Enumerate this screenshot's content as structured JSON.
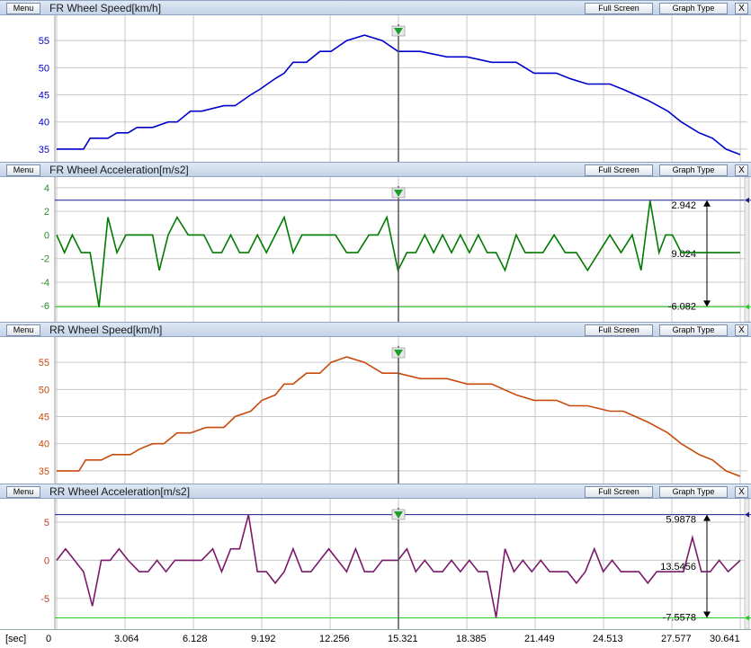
{
  "buttons": {
    "menu": "Menu",
    "full_screen": "Full Screen",
    "graph_type": "Graph Type",
    "close": "X"
  },
  "colors": {
    "blue": "#0000cc",
    "green": "#007a00",
    "orange": "#c84a0a",
    "purple": "#7a1a6a",
    "limit_upper": "#1c1c8c",
    "limit_lower": "#22cc22",
    "grid": "#c8c8c8",
    "cursor": "#555555"
  },
  "x_axis": {
    "unit": "[sec]",
    "ticks": [
      "0",
      "3.064",
      "6.128",
      "9.192",
      "12.256",
      "15.321",
      "18.385",
      "21.449",
      "24.513",
      "27.577",
      "30.641"
    ],
    "max": 30.641,
    "cursor_x": 15.321
  },
  "panels": [
    {
      "title": "FR Wheel Speed[km/h]",
      "menu_label": "Menu",
      "chart_data": {
        "type": "line",
        "ylim": [
          33,
          59
        ],
        "yticks": [
          35,
          40,
          45,
          50,
          55
        ],
        "tick_color": "#0000cc",
        "color": "#0000cc",
        "x": [
          0,
          1.2,
          1.5,
          2.3,
          2.7,
          3.2,
          3.6,
          4.3,
          5.0,
          5.4,
          6.0,
          6.5,
          7.5,
          8.0,
          8.7,
          9.1,
          9.8,
          10.2,
          10.6,
          11.2,
          11.8,
          12.3,
          13.0,
          13.8,
          14.6,
          15.3,
          16.3,
          17.5,
          18.4,
          19.5,
          20.6,
          21.4,
          22.4,
          23.0,
          23.8,
          24.8,
          25.4,
          26.5,
          27.4,
          28.0,
          28.8,
          29.4,
          30.0,
          30.641
        ],
        "y": [
          35,
          35,
          37,
          37,
          38,
          38,
          39,
          39,
          40,
          40,
          42,
          42,
          43,
          43,
          45,
          46,
          48,
          49,
          51,
          51,
          53,
          53,
          55,
          56,
          55,
          53,
          53,
          52,
          52,
          51,
          51,
          49,
          49,
          48,
          47,
          47,
          46,
          44,
          42,
          40,
          38,
          37,
          35,
          34
        ]
      },
      "markers": null
    },
    {
      "title": "FR Wheel Acceleration[m/s2]",
      "menu_label": "Menu",
      "chart_data": {
        "type": "line",
        "ylim": [
          -7.2,
          4.6
        ],
        "yticks": [
          4,
          2,
          0,
          -2,
          -4,
          -6
        ],
        "tick_color": "#2a8a2a",
        "color": "#007a00",
        "x": [
          0,
          0.35,
          0.7,
          1.1,
          1.5,
          1.9,
          2.3,
          2.7,
          3.1,
          3.5,
          4.0,
          4.3,
          4.6,
          5.0,
          5.4,
          5.9,
          6.2,
          6.6,
          7.0,
          7.4,
          7.8,
          8.2,
          8.6,
          9.0,
          9.4,
          9.8,
          10.2,
          10.6,
          11.0,
          11.5,
          12.0,
          12.5,
          13.0,
          13.5,
          14.0,
          14.4,
          14.8,
          15.3,
          15.7,
          16.1,
          16.5,
          16.9,
          17.3,
          17.7,
          18.1,
          18.5,
          18.9,
          19.3,
          19.7,
          20.1,
          20.6,
          21.0,
          21.4,
          21.8,
          22.3,
          22.8,
          23.3,
          23.8,
          24.3,
          24.8,
          25.3,
          25.8,
          26.2,
          26.6,
          27.0,
          27.3,
          27.6,
          28.0,
          28.4,
          28.8,
          29.3,
          29.8,
          30.2,
          30.641
        ],
        "y": [
          0,
          -1.5,
          0,
          -1.5,
          -1.5,
          -6.1,
          1.5,
          -1.5,
          0,
          0,
          0,
          0,
          -3.0,
          0,
          1.5,
          0,
          0,
          0,
          -1.5,
          -1.5,
          0,
          -1.5,
          -1.5,
          0,
          -1.5,
          0,
          1.5,
          -1.5,
          0,
          0,
          0,
          0,
          -1.5,
          -1.5,
          0,
          0,
          1.5,
          -3.0,
          -1.5,
          -1.5,
          0,
          -1.5,
          0,
          -1.5,
          0,
          -1.5,
          0,
          -1.5,
          -1.5,
          -3.0,
          0,
          -1.5,
          -1.5,
          -1.5,
          0,
          -1.5,
          -1.5,
          -3.0,
          -1.5,
          0,
          -1.5,
          0,
          -3.0,
          2.9,
          -1.5,
          0,
          0,
          -1.5,
          -1.5,
          -1.5,
          -1.5,
          -1.5,
          -1.5,
          -1.5
        ]
      },
      "markers": {
        "upper": 2.942,
        "lower": -6.082,
        "upper_label": "2.942",
        "mid_label": "9.024",
        "lower_label": "-6.082"
      }
    },
    {
      "title": "RR Wheel Speed[km/h]",
      "menu_label": "Menu",
      "chart_data": {
        "type": "line",
        "ylim": [
          33,
          59
        ],
        "yticks": [
          35,
          40,
          45,
          50,
          55
        ],
        "tick_color": "#c84a0a",
        "color": "#c84a0a",
        "x": [
          0,
          1.0,
          1.3,
          2.0,
          2.5,
          3.3,
          3.7,
          4.3,
          4.8,
          5.4,
          6.0,
          6.7,
          7.5,
          8.0,
          8.7,
          9.2,
          9.8,
          10.2,
          10.6,
          11.2,
          11.8,
          12.3,
          13.0,
          13.8,
          14.6,
          15.3,
          16.3,
          17.5,
          18.4,
          19.5,
          20.6,
          21.4,
          22.4,
          23.0,
          23.8,
          24.8,
          25.4,
          26.5,
          27.4,
          28.0,
          28.8,
          29.4,
          30.0,
          30.641
        ],
        "y": [
          35,
          35,
          37,
          37,
          38,
          38,
          39,
          40,
          40,
          42,
          42,
          43,
          43,
          45,
          46,
          48,
          49,
          51,
          51,
          53,
          53,
          55,
          56,
          55,
          53,
          53,
          52,
          52,
          51,
          51,
          49,
          48,
          48,
          47,
          47,
          46,
          46,
          44,
          42,
          40,
          38,
          37,
          35,
          34
        ]
      },
      "markers": null
    },
    {
      "title": "RR Wheel Acceleration[m/s2]",
      "menu_label": "Menu",
      "chart_data": {
        "type": "line",
        "ylim": [
          -8.8,
          7.6
        ],
        "yticks": [
          5,
          0,
          -5
        ],
        "tick_color": "#c0392b",
        "color": "#7a1a6a",
        "x": [
          0,
          0.4,
          0.8,
          1.2,
          1.6,
          2.0,
          2.4,
          2.8,
          3.2,
          3.7,
          4.1,
          4.5,
          4.9,
          5.3,
          5.7,
          6.1,
          6.5,
          7.0,
          7.4,
          7.8,
          8.2,
          8.6,
          9.0,
          9.4,
          9.8,
          10.2,
          10.6,
          11.0,
          11.4,
          11.8,
          12.2,
          12.6,
          13.0,
          13.4,
          13.8,
          14.2,
          14.6,
          15.0,
          15.3,
          15.7,
          16.1,
          16.5,
          16.9,
          17.3,
          17.7,
          18.1,
          18.5,
          18.9,
          19.3,
          19.7,
          20.1,
          20.5,
          20.9,
          21.3,
          21.7,
          22.1,
          22.5,
          22.9,
          23.3,
          23.7,
          24.1,
          24.5,
          24.9,
          25.3,
          25.7,
          26.1,
          26.5,
          26.9,
          27.3,
          27.7,
          28.1,
          28.5,
          28.9,
          29.3,
          29.7,
          30.1,
          30.641
        ],
        "y": [
          0,
          1.5,
          0,
          -1.5,
          -6.0,
          0,
          0,
          1.5,
          0,
          -1.5,
          -1.5,
          0,
          -1.5,
          0,
          0,
          0,
          0,
          1.5,
          -1.5,
          1.5,
          1.5,
          6.0,
          -1.5,
          -1.5,
          -3.0,
          -1.5,
          1.5,
          -1.5,
          -1.5,
          0,
          1.5,
          0,
          -1.5,
          1.5,
          -1.5,
          -1.5,
          0,
          0,
          0,
          1.5,
          -1.5,
          0,
          -1.5,
          -1.5,
          0,
          -1.5,
          0,
          -1.5,
          -1.5,
          -7.5,
          1.5,
          -1.5,
          0,
          -1.5,
          0,
          -1.5,
          -1.5,
          -1.5,
          -3.0,
          -1.5,
          1.5,
          -1.5,
          0,
          -1.5,
          -1.5,
          -1.5,
          -3.0,
          -1.5,
          -1.5,
          -1.5,
          -1.5,
          3.0,
          -1.5,
          -1.5,
          0,
          -1.5,
          0
        ]
      },
      "markers": {
        "upper": 5.9878,
        "lower": -7.5578,
        "upper_label": "5.9878",
        "mid_label": "13.5456",
        "lower_label": "-7.5578"
      }
    }
  ]
}
